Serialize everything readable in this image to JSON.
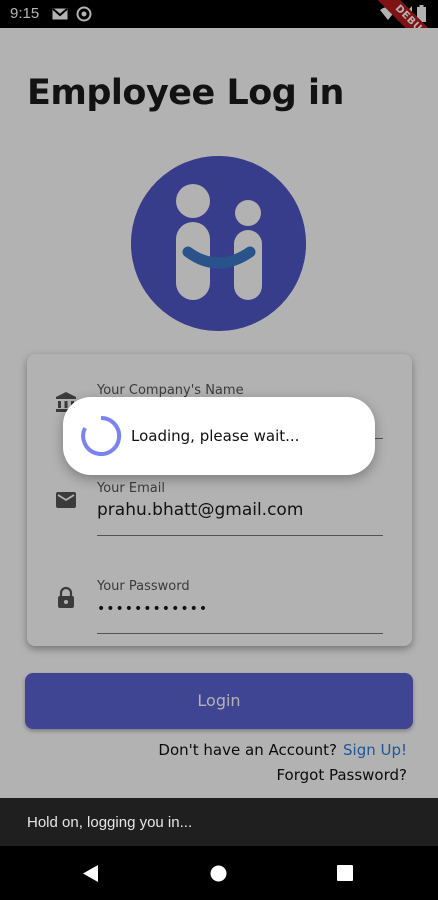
{
  "status_bar": {
    "time": "9:15",
    "debug_label": "DEBUG"
  },
  "page": {
    "title": "Employee Log in"
  },
  "form": {
    "company": {
      "label": "Your Company's Name",
      "value": ""
    },
    "email": {
      "label": "Your Email",
      "value": "prahu.bhatt@gmail.com"
    },
    "password": {
      "label": "Your Password",
      "value": "••••••••••••"
    }
  },
  "actions": {
    "login_label": "Login",
    "account_question": "Don't have an Account?",
    "signup_label": "Sign Up!",
    "forgot_label": "Forgot Password?"
  },
  "dialog": {
    "message": "Loading, please wait..."
  },
  "snackbar": {
    "message": "Hold on, logging you in..."
  },
  "colors": {
    "brand": "#4f56c7",
    "button": "#5b63d3",
    "link": "#2f7dd6",
    "spinner": "#7b83f0"
  },
  "icons": [
    "gmail-icon",
    "vpn-icon",
    "wifi-icon",
    "signal-icon",
    "battery-icon",
    "bank-icon",
    "email-icon",
    "lock-icon",
    "back-icon",
    "home-icon",
    "recents-icon"
  ]
}
